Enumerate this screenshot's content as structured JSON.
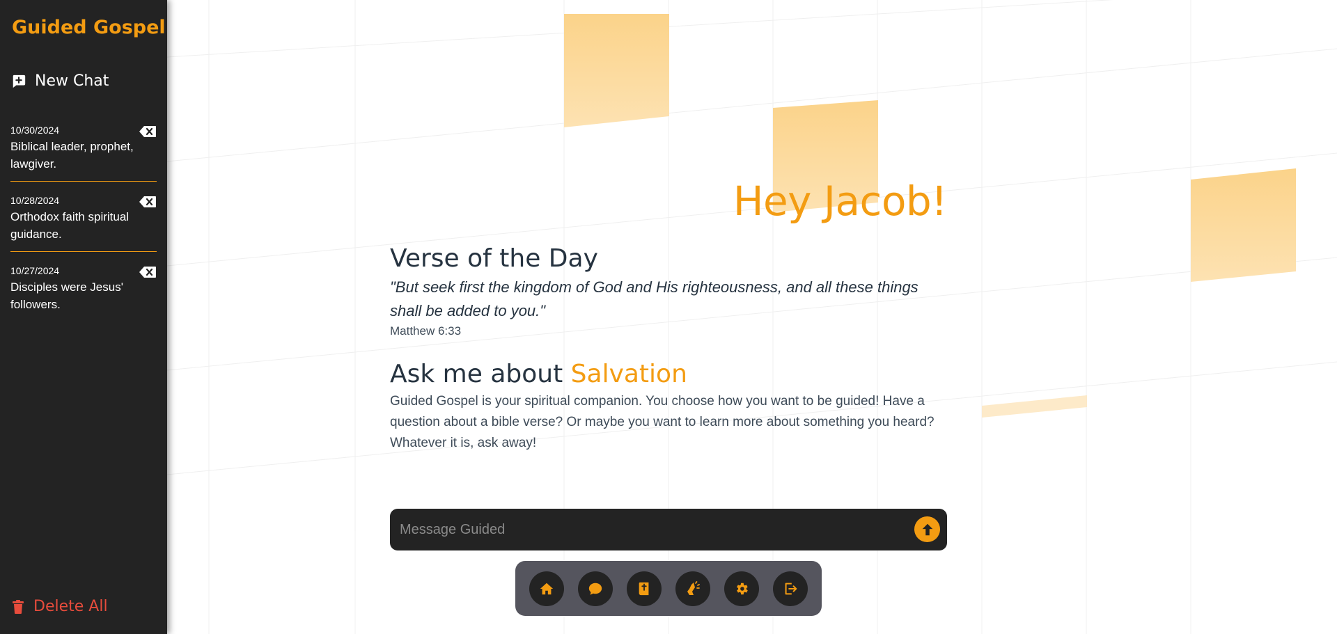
{
  "app": {
    "brand": "Guided Gospel"
  },
  "sidebar": {
    "new_chat_label": "New Chat",
    "history": [
      {
        "date": "10/30/2024",
        "title": "Biblical leader, prophet, lawgiver."
      },
      {
        "date": "10/28/2024",
        "title": "Orthodox faith spiritual guidance."
      },
      {
        "date": "10/27/2024",
        "title": "Disciples were Jesus' followers."
      }
    ],
    "delete_all_label": "Delete All"
  },
  "main": {
    "greeting": "Hey Jacob!",
    "verse_heading": "Verse of the Day",
    "verse_text": "\"But seek first the kingdom of God and His righteousness, and all these things shall be added to you.\"",
    "verse_reference": "Matthew 6:33",
    "ask_prefix": "Ask me about ",
    "ask_topic": "Salvation",
    "description": "Guided Gospel is your spiritual companion. You choose how you want to be guided! Have a question about a bible verse? Or maybe you want to learn more about something you heard? Whatever it is, ask away!"
  },
  "message": {
    "placeholder": "Message Guided",
    "value": ""
  },
  "dock": {
    "items": [
      {
        "name": "home",
        "icon": "home-icon"
      },
      {
        "name": "chat",
        "icon": "chat-bubble-icon"
      },
      {
        "name": "bible",
        "icon": "bible-icon"
      },
      {
        "name": "prayer",
        "icon": "praying-hands-icon"
      },
      {
        "name": "settings",
        "icon": "gear-icon"
      },
      {
        "name": "logout",
        "icon": "logout-icon"
      }
    ]
  },
  "colors": {
    "accent": "#f39c12",
    "sidebar_bg": "#232323",
    "danger": "#e74c3c",
    "text": "#263340",
    "dock_bg": "#55555e"
  }
}
